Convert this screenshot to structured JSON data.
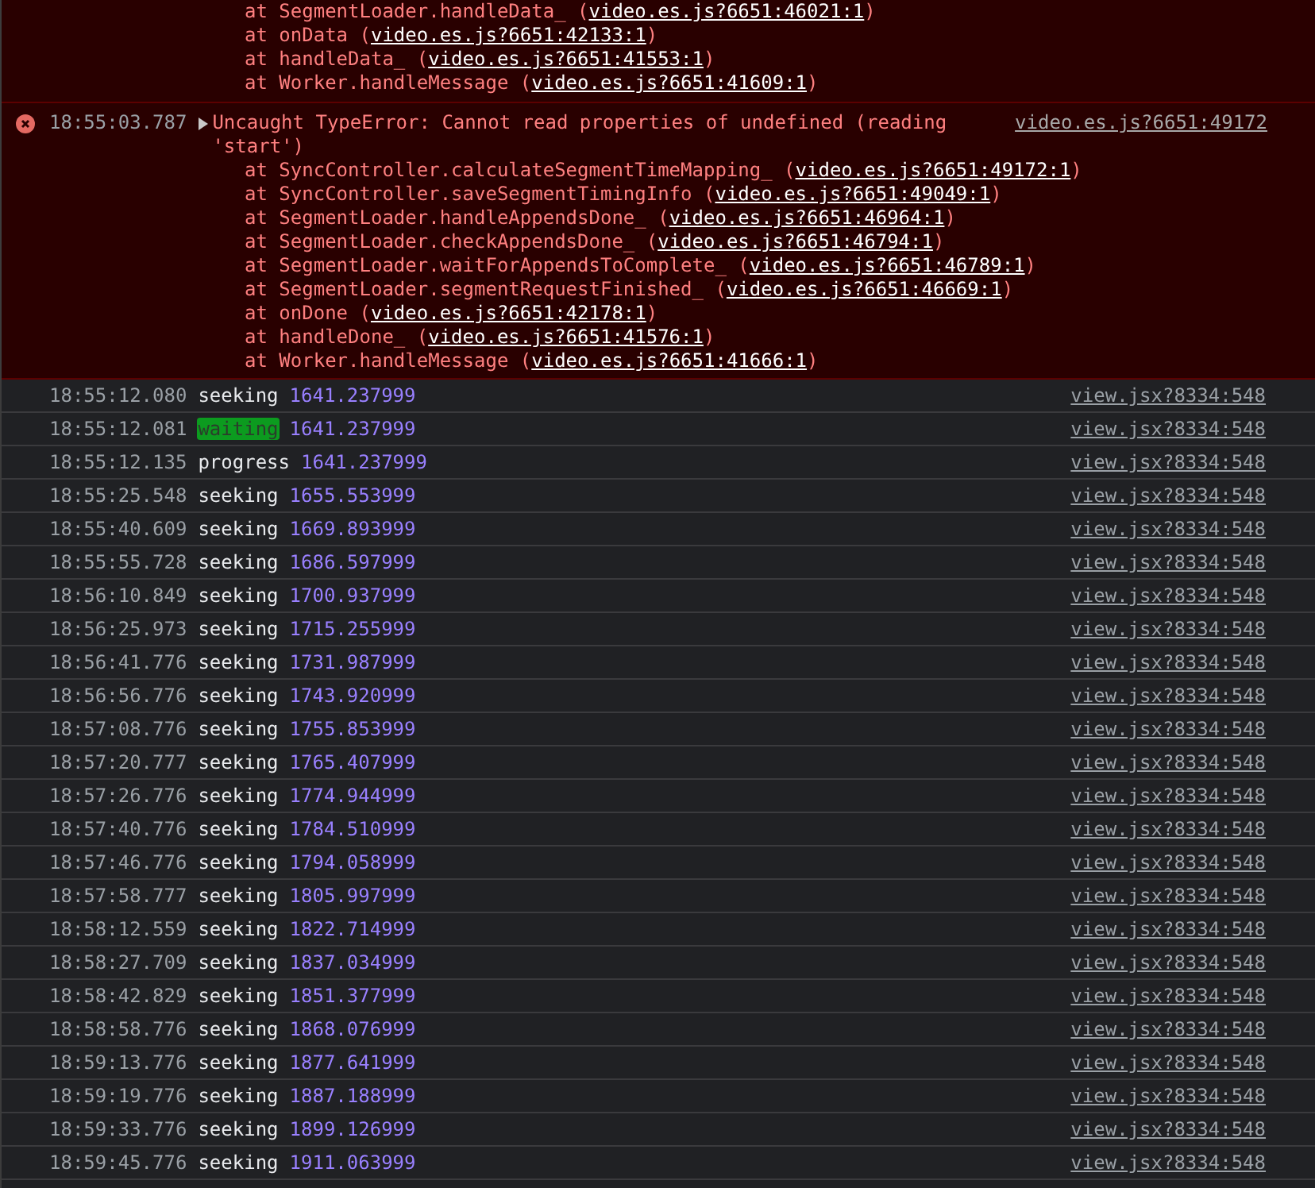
{
  "error_continuation": {
    "frames": [
      {
        "text": "at SegmentLoader.handleData_ (",
        "link": "video.es.js?6651:46021:1",
        "tail": ")"
      },
      {
        "text": "at onData (",
        "link": "video.es.js?6651:42133:1",
        "tail": ")"
      },
      {
        "text": "at handleData_ (",
        "link": "video.es.js?6651:41553:1",
        "tail": ")"
      },
      {
        "text": "at Worker.handleMessage (",
        "link": "video.es.js?6651:41609:1",
        "tail": ")"
      }
    ]
  },
  "error": {
    "time": "18:55:03.787",
    "message": "Uncaught TypeError: Cannot read properties of undefined (reading 'start')",
    "source": "video.es.js?6651:49172",
    "frames": [
      {
        "text": "at SyncController.calculateSegmentTimeMapping_ (",
        "link": "video.es.js?6651:49172:1",
        "tail": ")"
      },
      {
        "text": "at SyncController.saveSegmentTimingInfo (",
        "link": "video.es.js?6651:49049:1",
        "tail": ")"
      },
      {
        "text": "at SegmentLoader.handleAppendsDone_ (",
        "link": "video.es.js?6651:46964:1",
        "tail": ")"
      },
      {
        "text": "at SegmentLoader.checkAppendsDone_ (",
        "link": "video.es.js?6651:46794:1",
        "tail": ")"
      },
      {
        "text": "at SegmentLoader.waitForAppendsToComplete_ (",
        "link": "video.es.js?6651:46789:1",
        "tail": ")"
      },
      {
        "text": "at SegmentLoader.segmentRequestFinished_ (",
        "link": "video.es.js?6651:46669:1",
        "tail": ")"
      },
      {
        "text": "at onDone (",
        "link": "video.es.js?6651:42178:1",
        "tail": ")"
      },
      {
        "text": "at handleDone_ (",
        "link": "video.es.js?6651:41576:1",
        "tail": ")"
      },
      {
        "text": "at Worker.handleMessage (",
        "link": "video.es.js?6651:41666:1",
        "tail": ")"
      }
    ]
  },
  "logs": [
    {
      "time": "18:55:12.080",
      "event": "seeking",
      "highlighted": false,
      "value": "1641.237999",
      "source": "view.jsx?8334:548"
    },
    {
      "time": "18:55:12.081",
      "event": "waiting",
      "highlighted": true,
      "value": "1641.237999",
      "source": "view.jsx?8334:548"
    },
    {
      "time": "18:55:12.135",
      "event": "progress",
      "highlighted": false,
      "value": "1641.237999",
      "source": "view.jsx?8334:548"
    },
    {
      "time": "18:55:25.548",
      "event": "seeking",
      "highlighted": false,
      "value": "1655.553999",
      "source": "view.jsx?8334:548"
    },
    {
      "time": "18:55:40.609",
      "event": "seeking",
      "highlighted": false,
      "value": "1669.893999",
      "source": "view.jsx?8334:548"
    },
    {
      "time": "18:55:55.728",
      "event": "seeking",
      "highlighted": false,
      "value": "1686.597999",
      "source": "view.jsx?8334:548"
    },
    {
      "time": "18:56:10.849",
      "event": "seeking",
      "highlighted": false,
      "value": "1700.937999",
      "source": "view.jsx?8334:548"
    },
    {
      "time": "18:56:25.973",
      "event": "seeking",
      "highlighted": false,
      "value": "1715.255999",
      "source": "view.jsx?8334:548"
    },
    {
      "time": "18:56:41.776",
      "event": "seeking",
      "highlighted": false,
      "value": "1731.987999",
      "source": "view.jsx?8334:548"
    },
    {
      "time": "18:56:56.776",
      "event": "seeking",
      "highlighted": false,
      "value": "1743.920999",
      "source": "view.jsx?8334:548"
    },
    {
      "time": "18:57:08.776",
      "event": "seeking",
      "highlighted": false,
      "value": "1755.853999",
      "source": "view.jsx?8334:548"
    },
    {
      "time": "18:57:20.777",
      "event": "seeking",
      "highlighted": false,
      "value": "1765.407999",
      "source": "view.jsx?8334:548"
    },
    {
      "time": "18:57:26.776",
      "event": "seeking",
      "highlighted": false,
      "value": "1774.944999",
      "source": "view.jsx?8334:548"
    },
    {
      "time": "18:57:40.776",
      "event": "seeking",
      "highlighted": false,
      "value": "1784.510999",
      "source": "view.jsx?8334:548"
    },
    {
      "time": "18:57:46.776",
      "event": "seeking",
      "highlighted": false,
      "value": "1794.058999",
      "source": "view.jsx?8334:548"
    },
    {
      "time": "18:57:58.777",
      "event": "seeking",
      "highlighted": false,
      "value": "1805.997999",
      "source": "view.jsx?8334:548"
    },
    {
      "time": "18:58:12.559",
      "event": "seeking",
      "highlighted": false,
      "value": "1822.714999",
      "source": "view.jsx?8334:548"
    },
    {
      "time": "18:58:27.709",
      "event": "seeking",
      "highlighted": false,
      "value": "1837.034999",
      "source": "view.jsx?8334:548"
    },
    {
      "time": "18:58:42.829",
      "event": "seeking",
      "highlighted": false,
      "value": "1851.377999",
      "source": "view.jsx?8334:548"
    },
    {
      "time": "18:58:58.776",
      "event": "seeking",
      "highlighted": false,
      "value": "1868.076999",
      "source": "view.jsx?8334:548"
    },
    {
      "time": "18:59:13.776",
      "event": "seeking",
      "highlighted": false,
      "value": "1877.641999",
      "source": "view.jsx?8334:548"
    },
    {
      "time": "18:59:19.776",
      "event": "seeking",
      "highlighted": false,
      "value": "1887.188999",
      "source": "view.jsx?8334:548"
    },
    {
      "time": "18:59:33.776",
      "event": "seeking",
      "highlighted": false,
      "value": "1899.126999",
      "source": "view.jsx?8334:548"
    },
    {
      "time": "18:59:45.776",
      "event": "seeking",
      "highlighted": false,
      "value": "1911.063999",
      "source": "view.jsx?8334:548"
    }
  ]
}
